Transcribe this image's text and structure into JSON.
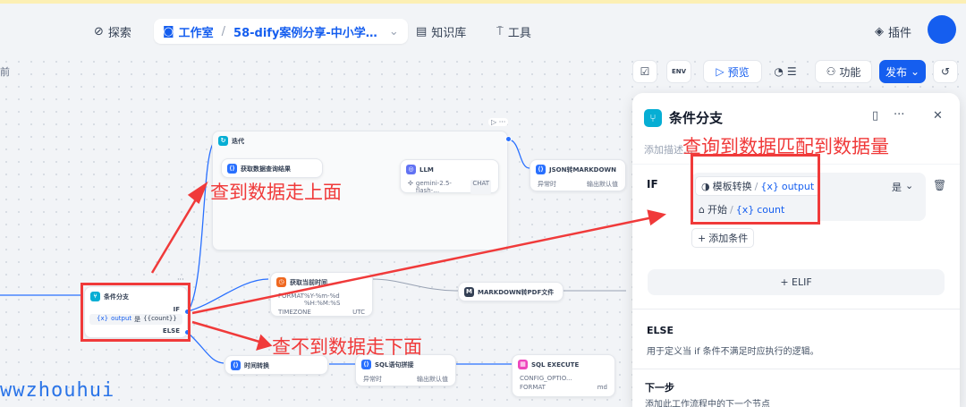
{
  "nav": {
    "explore": "探索",
    "studio": "工作室",
    "app_name": "58-dify案例分享-中小学…",
    "knowledge": "知识库",
    "tools": "工具",
    "plugins": "插件"
  },
  "canvas": {
    "corner_text": "前"
  },
  "toolbar": {
    "env": "ENV",
    "preview": "预览",
    "features": "功能",
    "publish": "发布"
  },
  "nodes": {
    "iteration": {
      "title": "迭代",
      "child1": "获取数据查询结果",
      "llm_title": "LLM",
      "llm_model": "gemini-2.5-flash-…",
      "llm_badge": "CHAT"
    },
    "json_md": {
      "title": "JSON转MARKDOWN",
      "k1": "异常时",
      "v1": "输出默认值"
    },
    "if_else": {
      "title": "条件分支",
      "if": "IF",
      "cond_var": "output",
      "cond_op": "是",
      "cond_val": "{{count}}",
      "else": "ELSE"
    },
    "get_time": {
      "title": "获取当前时间",
      "k1": "FORMAT",
      "v1": "%Y-%m-%d %H:%M:%S",
      "k2": "TIMEZONE",
      "v2": "UTC"
    },
    "md_pdf": {
      "title": "MARKDOWN转PDF文件"
    },
    "time_conv": {
      "title": "时间转换"
    },
    "sql_concat": {
      "title": "SQL语句拼接",
      "k1": "异常时",
      "v1": "输出默认值"
    },
    "sql_exec": {
      "title": "SQL EXECUTE",
      "k1": "CONFIG_OPTIO...",
      "k2": "FORMAT",
      "v2": "md"
    }
  },
  "annotations": {
    "a1": "查到数据走上面",
    "a2": "查询到数据匹配到数据量",
    "a3": "查不到数据走下面"
  },
  "panel": {
    "title": "条件分支",
    "desc_placeholder": "添加描述…",
    "if": "IF",
    "cond1_node": "模板转换",
    "cond1_var": "output",
    "cond2_node": "开始",
    "cond2_var": "count",
    "operator": "是",
    "add_condition": "添加条件",
    "elif": "+ ELIF",
    "else_title": "ELSE",
    "else_desc": "用于定义当 if 条件不满足时应执行的逻辑。",
    "next_title": "下一步",
    "next_desc": "添加此工作流程中的下一个节点"
  },
  "watermark": "wwzhouhui"
}
